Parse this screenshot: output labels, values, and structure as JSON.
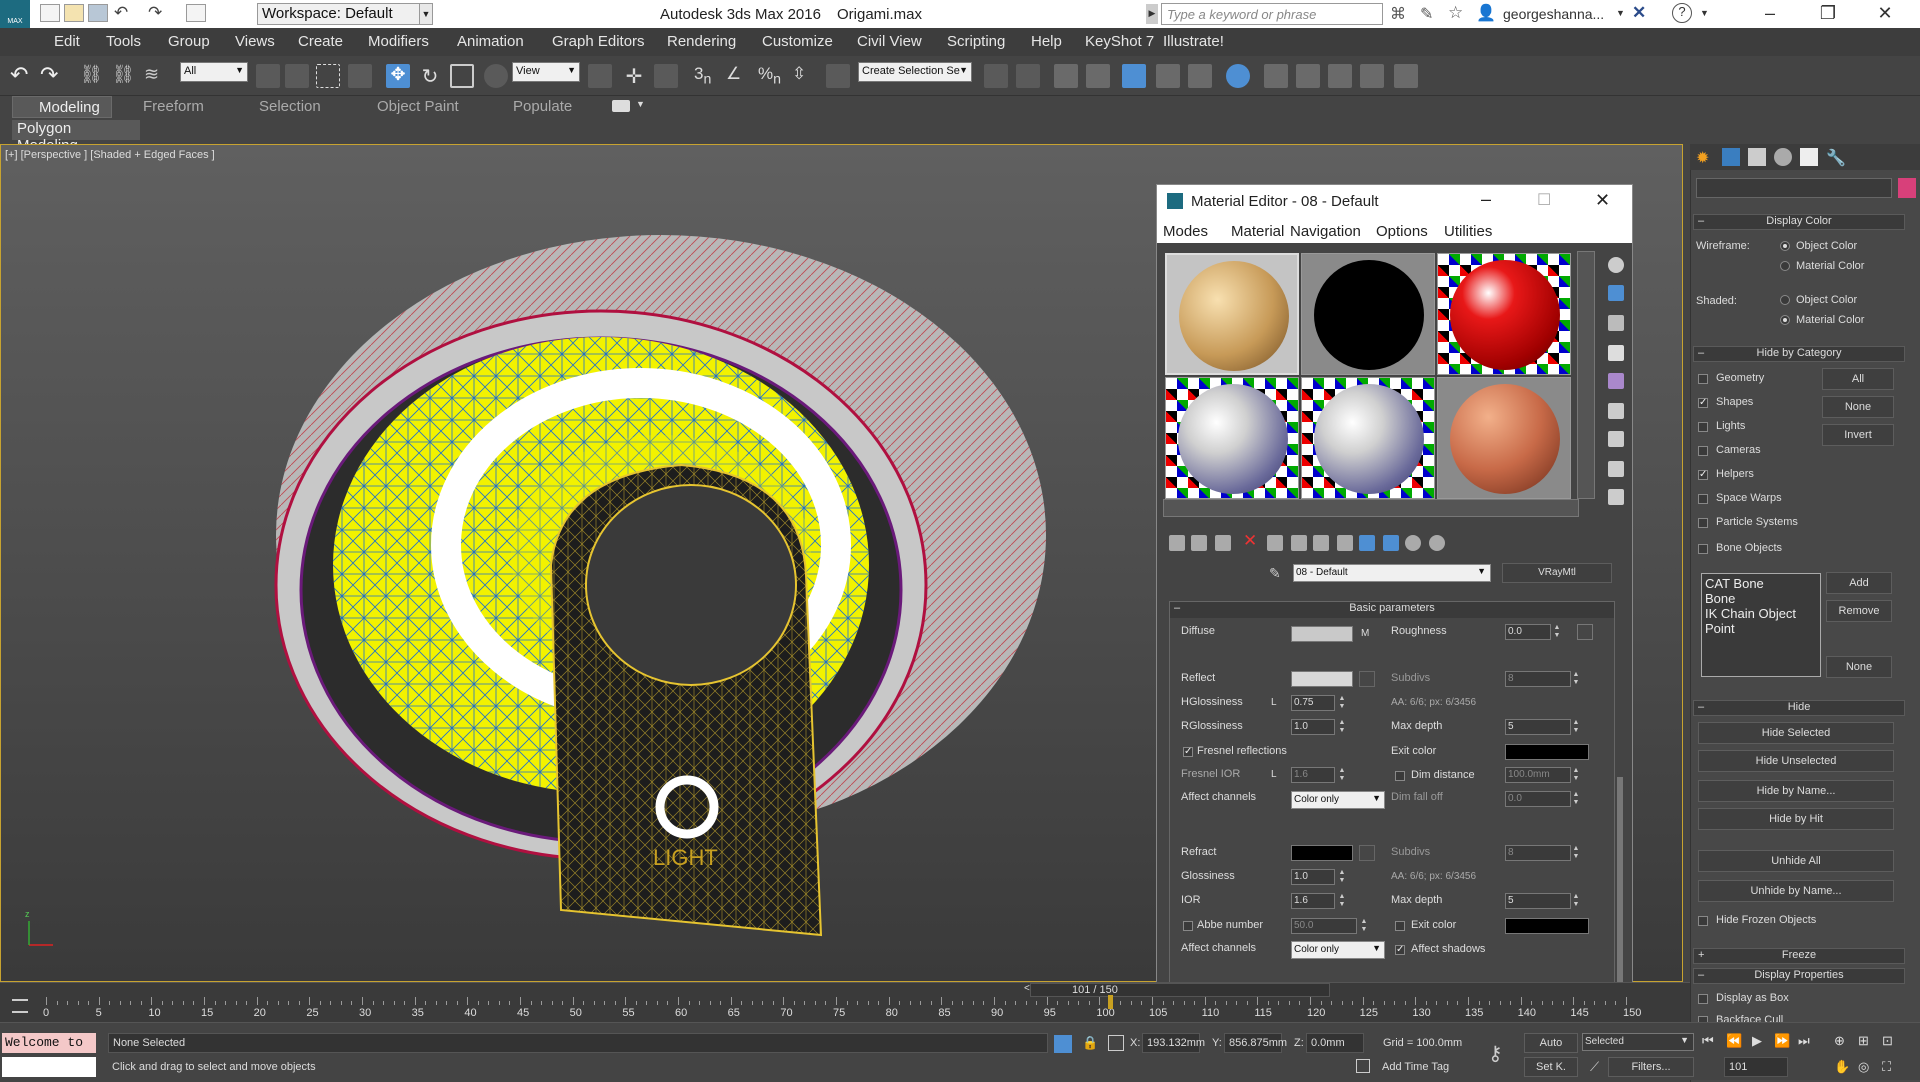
{
  "app": {
    "title": "Autodesk 3ds Max 2016",
    "file": "Origami.max",
    "logo": "MAX",
    "workspace": "Workspace: Default",
    "search_placeholder": "Type a keyword or phrase",
    "user": "georgeshanna...",
    "icons": [
      "new-icon",
      "open-icon",
      "save-icon",
      "undo-icon",
      "redo-icon",
      "binoculars-icon",
      "star-icon",
      "user-icon",
      "x-icon",
      "help-icon"
    ]
  },
  "menu": [
    "Edit",
    "Tools",
    "Group",
    "Views",
    "Create",
    "Modifiers",
    "Animation",
    "Graph Editors",
    "Rendering",
    "Customize",
    "Civil View",
    "Scripting",
    "Help",
    "KeyShot 7",
    "Illustrate!"
  ],
  "toolbar": {
    "filter": "All",
    "refcoord": "View",
    "selection_set": "Create Selection Se"
  },
  "ribbon": {
    "tabs": [
      "Modeling",
      "Freeform",
      "Selection",
      "Object Paint",
      "Populate"
    ],
    "active_tab": "Modeling",
    "panel": "Polygon Modeling"
  },
  "viewport": {
    "label": "[+] [Perspective ] [Shaded + Edged Faces ]",
    "logo_text": "LIGHT"
  },
  "material_editor": {
    "title": "Material Editor - 08 - Default",
    "menu": [
      "Modes",
      "Material",
      "Navigation",
      "Options",
      "Utilities"
    ],
    "material_name": "08 - Default",
    "material_type": "VRayMtl",
    "rollout": "Basic parameters",
    "diffuse_label": "Diffuse",
    "diffuse_map_btn": "M",
    "roughness_label": "Roughness",
    "roughness": "0.0",
    "reflect_label": "Reflect",
    "subdivs_label": "Subdivs",
    "reflect_subdivs": "8",
    "hgloss_label": "HGlossiness",
    "hgloss_lock": "L",
    "hgloss": "0.75",
    "aa_text": "AA: 6/6; px: 6/3456",
    "rgloss_label": "RGlossiness",
    "rgloss": "1.0",
    "maxdepth_label": "Max depth",
    "reflect_maxdepth": "5",
    "fresnel_label": "Fresnel reflections",
    "exitcolor_label": "Exit color",
    "fresnel_ior_label": "Fresnel IOR",
    "fresnel_ior_lock": "L",
    "fresnel_ior": "1.6",
    "dimdist_label": "Dim distance",
    "dimdist": "100.0mm",
    "affect_label": "Affect channels",
    "affect_value": "Color only",
    "dimfall_label": "Dim fall off",
    "dimfall": "0.0",
    "refract_label": "Refract",
    "refract_subdivs": "8",
    "gloss_label": "Glossiness",
    "gloss": "1.0",
    "aa_text2": "AA: 6/6; px: 6/3456",
    "ior_label": "IOR",
    "ior": "1.6",
    "refract_maxdepth": "5",
    "abbe_label": "Abbe number",
    "abbe": "50.0",
    "exitcolor2_label": "Exit color",
    "affect2_value": "Color only",
    "affect_shadows_label": "Affect shadows"
  },
  "command_panel": {
    "display_color": "Display Color",
    "wireframe": "Wireframe:",
    "shaded": "Shaded:",
    "object_color": "Object Color",
    "material_color": "Material Color",
    "hide_by_category": "Hide by Category",
    "categories": [
      "Geometry",
      "Shapes",
      "Lights",
      "Cameras",
      "Helpers",
      "Space Warps",
      "Particle Systems",
      "Bone Objects"
    ],
    "cat_checked": [
      false,
      true,
      false,
      false,
      true,
      false,
      false,
      false
    ],
    "all_btn": "All",
    "none_btn": "None",
    "invert_btn": "Invert",
    "list_items": [
      "CAT Bone",
      "Bone",
      "IK Chain Object",
      "Point"
    ],
    "add_btn": "Add",
    "remove_btn": "Remove",
    "none2_btn": "None",
    "hide": "Hide",
    "hide_selected": "Hide Selected",
    "hide_unselected": "Hide Unselected",
    "hide_by_name": "Hide by Name...",
    "hide_by_hit": "Hide by Hit",
    "unhide_all": "Unhide All",
    "unhide_by_name": "Unhide by Name...",
    "hide_frozen": "Hide Frozen Objects",
    "freeze": "Freeze",
    "display_props": "Display Properties",
    "display_as_box": "Display as Box",
    "backface": "Backface Cull"
  },
  "timeline": {
    "frame_label": "101 / 150",
    "current_frame": 101,
    "total": 150,
    "ticks": [
      "0",
      "5",
      "10",
      "15",
      "20",
      "25",
      "30",
      "35",
      "40",
      "45",
      "50",
      "55",
      "60",
      "65",
      "70",
      "75",
      "80",
      "85",
      "90",
      "95",
      "100",
      "105",
      "110",
      "115",
      "120",
      "125",
      "130",
      "135",
      "140",
      "145",
      "150"
    ]
  },
  "status": {
    "script_text": "Welcome to",
    "selection": "None Selected",
    "prompt": "Click and drag to select and move objects",
    "x_label": "X:",
    "x": "193.132mm",
    "y_label": "Y:",
    "y": "856.875mm",
    "z_label": "Z:",
    "z": "0.0mm",
    "grid": "Grid = 100.0mm",
    "add_time_tag": "Add Time Tag",
    "auto": "Auto",
    "set_key": "Set K.",
    "key_filter": "Selected",
    "filters": "Filters...",
    "frame": "101"
  },
  "colors": {
    "accent": "#3a9ad9",
    "viewport_border": "#c7a330",
    "yellow": "#f2f200"
  }
}
